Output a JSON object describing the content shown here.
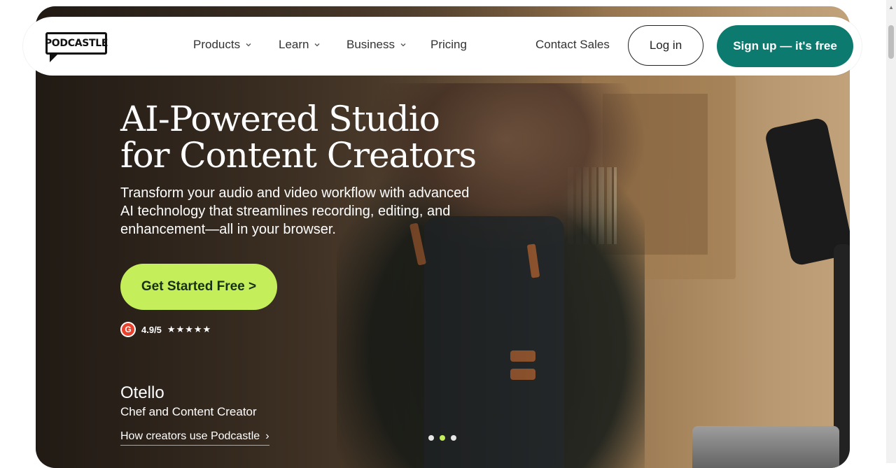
{
  "brand": {
    "logo_text": "PODCASTLE"
  },
  "nav": {
    "items": [
      {
        "label": "Products",
        "has_dropdown": true
      },
      {
        "label": "Learn",
        "has_dropdown": true
      },
      {
        "label": "Business",
        "has_dropdown": true
      },
      {
        "label": "Pricing",
        "has_dropdown": false
      }
    ],
    "contact_sales": "Contact Sales",
    "login": "Log in",
    "signup": "Sign up — it's free"
  },
  "hero": {
    "title_line1": "AI-Powered Studio",
    "title_line2": "for Content Creators",
    "subtitle": "Transform your audio and video workflow with advanced AI technology that streamlines recording, editing, and enhancement—all in your browser.",
    "cta_label": "Get Started Free >",
    "rating": {
      "badge": "G",
      "score": "4.9/5",
      "stars": "★★★★★"
    },
    "creator": {
      "name": "Otello",
      "role": "Chef and Content Creator",
      "link_label": "How creators use Podcastle",
      "link_arrow": "›"
    },
    "carousel": {
      "count": 3,
      "active_index": 1
    }
  },
  "colors": {
    "signup_bg": "#0d7a70",
    "cta_bg": "#c4ee5a",
    "cta_text": "#173118",
    "active_dot": "#c4ee5a"
  }
}
